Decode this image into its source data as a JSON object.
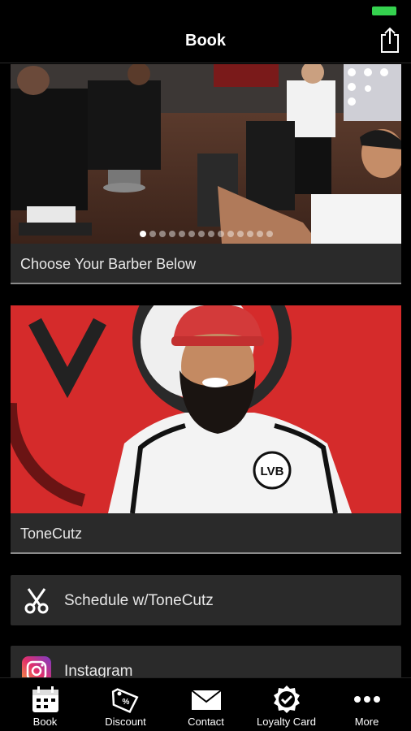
{
  "nav": {
    "title": "Book"
  },
  "hero": {
    "slide_count": 14,
    "active_slide": 0
  },
  "sections": {
    "choose_barber_label": "Choose Your Barber Below",
    "barber_name": "ToneCutz",
    "portrait_logo_text": "LVB"
  },
  "actions": [
    {
      "label": "Schedule w/ToneCutz",
      "icon": "scissors-icon"
    },
    {
      "label": "Instagram",
      "icon": "instagram-icon"
    }
  ],
  "tabs": [
    {
      "label": "Book",
      "icon": "calendar-icon"
    },
    {
      "label": "Discount",
      "icon": "tag-icon"
    },
    {
      "label": "Contact",
      "icon": "envelope-icon"
    },
    {
      "label": "Loyalty Card",
      "icon": "badge-icon"
    },
    {
      "label": "More",
      "icon": "more-icon"
    }
  ],
  "colors": {
    "background": "#000000",
    "row_background": "#2a2a2a",
    "battery": "#35d24f",
    "portrait_wall": "#d52b2b"
  }
}
